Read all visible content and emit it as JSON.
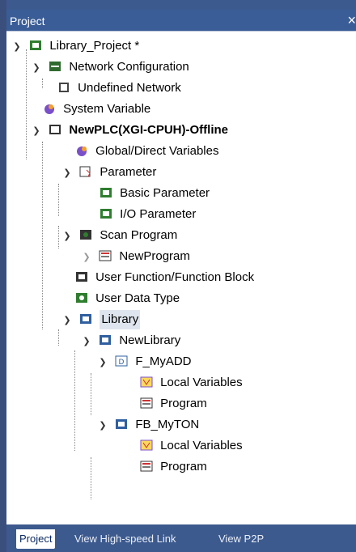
{
  "panel": {
    "title": "Project",
    "close_glyph": "×"
  },
  "tree": {
    "rows": [
      {
        "label": "Library_Project *",
        "icon": "project-icon"
      },
      {
        "label": "Network Configuration",
        "icon": "network-config-icon"
      },
      {
        "label": "Undefined Network",
        "icon": "undefined-network-icon"
      },
      {
        "label": "System Variable",
        "icon": "system-variable-icon"
      },
      {
        "label": "NewPLC(XGI-CPUH)-Offline",
        "icon": "plc-icon"
      },
      {
        "label": "Global/Direct Variables",
        "icon": "global-variables-icon"
      },
      {
        "label": "Parameter",
        "icon": "parameter-icon"
      },
      {
        "label": "Basic Parameter",
        "icon": "basic-parameter-icon"
      },
      {
        "label": "I/O Parameter",
        "icon": "io-parameter-icon"
      },
      {
        "label": "Scan Program",
        "icon": "scan-program-icon"
      },
      {
        "label": "NewProgram",
        "icon": "program-icon"
      },
      {
        "label": "User Function/Function Block",
        "icon": "user-function-icon"
      },
      {
        "label": "User Data Type",
        "icon": "user-data-type-icon"
      },
      {
        "label": "Library",
        "icon": "library-icon"
      },
      {
        "label": "NewLibrary",
        "icon": "library-item-icon"
      },
      {
        "label": "F_MyADD",
        "icon": "function-icon"
      },
      {
        "label": "Local Variables",
        "icon": "local-variables-icon"
      },
      {
        "label": "Program",
        "icon": "program-icon"
      },
      {
        "label": "FB_MyTON",
        "icon": "function-block-icon"
      },
      {
        "label": "Local Variables",
        "icon": "local-variables-icon"
      },
      {
        "label": "Program",
        "icon": "program-icon"
      }
    ]
  },
  "tabs": [
    {
      "label": "Project",
      "active": true
    },
    {
      "label": "View High-speed Link",
      "active": false
    },
    {
      "label": "View P2P",
      "active": false
    }
  ],
  "colors": {
    "panel_bg": "#3c5a8e",
    "tree_bg": "#ffffff",
    "selected_bg": "#dfe5ee"
  }
}
